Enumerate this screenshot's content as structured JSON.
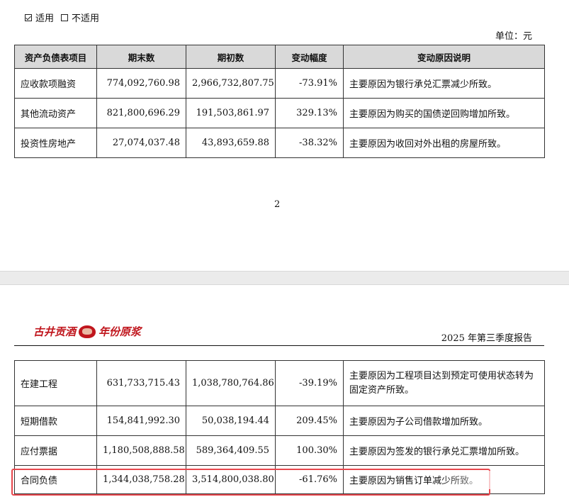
{
  "page1": {
    "checkbox_applicable": "适用",
    "checkbox_not_applicable": "不适用",
    "unit": "单位：元",
    "table": {
      "headers": [
        "资产负债表项目",
        "期末数",
        "期初数",
        "变动幅度",
        "变动原因说明"
      ],
      "rows": [
        [
          "应收款项融资",
          "774,092,760.98",
          "2,966,732,807.75",
          "-73.91%",
          "主要原因为银行承兑汇票减少所致。"
        ],
        [
          "其他流动资产",
          "821,800,696.29",
          "191,503,861.97",
          "329.13%",
          "主要原因为购买的国债逆回购增加所致。"
        ],
        [
          "投资性房地产",
          "27,074,037.48",
          "43,893,659.88",
          "-38.32%",
          "主要原因为收回对外出租的房屋所致。"
        ]
      ]
    },
    "page_number": "2"
  },
  "page2": {
    "logo_left": "古井贡酒",
    "logo_right": "年份原浆",
    "report_title": "2025 年第三季度报告",
    "table": {
      "rows": [
        [
          "在建工程",
          "631,733,715.43",
          "1,038,780,764.86",
          "-39.19%",
          "主要原因为工程项目达到预定可使用状态转为固定资产所致。"
        ],
        [
          "短期借款",
          "154,841,992.30",
          "50,038,194.44",
          "209.45%",
          "主要原因为子公司借款增加所致。"
        ],
        [
          "应付票据",
          "1,180,508,888.58",
          "589,364,409.55",
          "100.30%",
          "主要原因为签发的银行承兑汇票增加所致。"
        ],
        [
          "合同负债",
          "1,344,038,758.28",
          "3,514,800,038.80",
          "-61.76%",
          "主要原因为销售订单减少所致。"
        ]
      ]
    }
  },
  "colors": {
    "header_bg": "#d9d9d9",
    "highlight": "#e8474d",
    "logo": "#c0161d"
  }
}
